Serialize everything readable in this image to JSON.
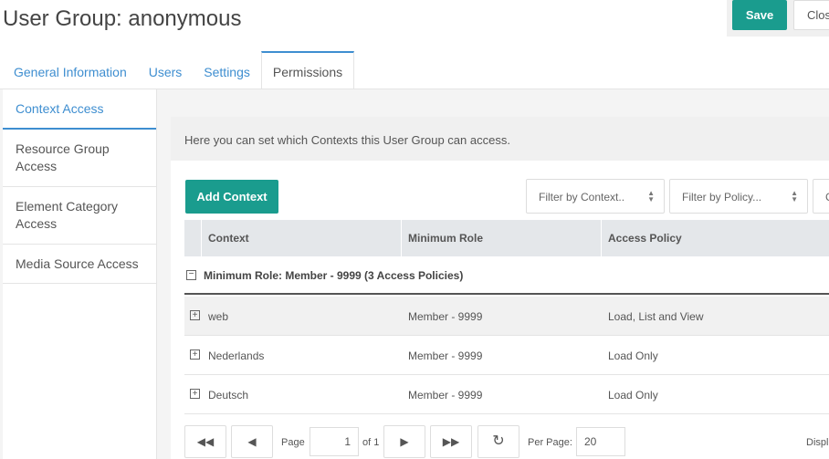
{
  "header": {
    "title": "User Group: anonymous",
    "save_label": "Save",
    "close_label": "Clos"
  },
  "tabs": [
    {
      "label": "General Information"
    },
    {
      "label": "Users"
    },
    {
      "label": "Settings"
    },
    {
      "label": "Permissions",
      "active": true
    }
  ],
  "vtabs": [
    {
      "label": "Context Access",
      "active": true
    },
    {
      "label": "Resource Group Access"
    },
    {
      "label": "Element Category Access"
    },
    {
      "label": "Media Source Access"
    }
  ],
  "content": {
    "info": "Here you can set which Contexts this User Group can access.",
    "add_label": "Add Context",
    "filter_context": "Filter by Context..",
    "filter_policy": "Filter by Policy...",
    "filter_third": "C"
  },
  "grid": {
    "columns": [
      "Context",
      "Minimum Role",
      "Access Policy"
    ],
    "group_label": "Minimum Role: Member - 9999 (3 Access Policies)",
    "rows": [
      {
        "context": "web",
        "role": "Member - 9999",
        "policy": "Load, List and View"
      },
      {
        "context": "Nederlands",
        "role": "Member - 9999",
        "policy": "Load Only"
      },
      {
        "context": "Deutsch",
        "role": "Member - 9999",
        "policy": "Load Only"
      }
    ]
  },
  "pager": {
    "first_icon": "double-left-icon",
    "prev_icon": "left-triangle-icon",
    "next_icon": "right-triangle-icon",
    "last_icon": "double-right-icon",
    "refresh_icon": "refresh-icon",
    "page_label": "Page",
    "page_value": "1",
    "of_label": "of 1",
    "per_page_label": "Per Page:",
    "per_page_value": "20",
    "display_label": "Displ"
  },
  "colors": {
    "accent": "#1a9c8e",
    "link": "#3e8ed0"
  }
}
